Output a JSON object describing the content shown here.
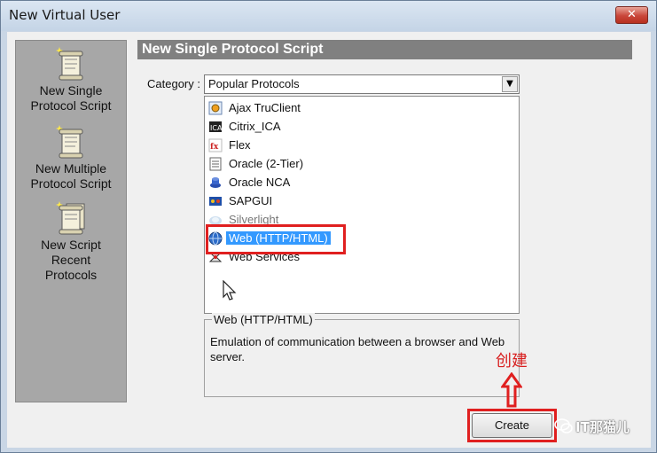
{
  "window": {
    "title": "New Virtual User",
    "close_label": "✕"
  },
  "sidebar": {
    "items": [
      {
        "label_line1": "New Single",
        "label_line2": "Protocol Script",
        "label_line3": ""
      },
      {
        "label_line1": "New Multiple",
        "label_line2": "Protocol Script",
        "label_line3": ""
      },
      {
        "label_line1": "New Script",
        "label_line2": "Recent",
        "label_line3": "Protocols"
      }
    ]
  },
  "main": {
    "section_title": "New Single Protocol Script",
    "category_label": "Category :",
    "category_value": "Popular Protocols",
    "protocols": [
      {
        "label": "Ajax TruClient",
        "icon": "ajax-truclient-icon"
      },
      {
        "label": "Citrix_ICA",
        "icon": "citrix-icon"
      },
      {
        "label": "Flex",
        "icon": "flex-icon"
      },
      {
        "label": "Oracle (2-Tier)",
        "icon": "oracle-2tier-icon"
      },
      {
        "label": "Oracle NCA",
        "icon": "oracle-nca-icon"
      },
      {
        "label": "SAPGUI",
        "icon": "sapgui-icon"
      },
      {
        "label": "Silverlight",
        "icon": "silverlight-icon"
      },
      {
        "label": "Web (HTTP/HTML)",
        "icon": "web-http-icon"
      },
      {
        "label": "Web Services",
        "icon": "web-services-icon"
      }
    ],
    "selected_index": 7,
    "description_title": "Web (HTTP/HTML)",
    "description_text": "Emulation of communication between a browser and Web server.",
    "create_label": "Create",
    "annotation": "创建",
    "watermark": "IT那猫儿"
  },
  "colors": {
    "highlight": "#e02020",
    "selection": "#3399ff",
    "sidebar": "#a7a7a7"
  }
}
